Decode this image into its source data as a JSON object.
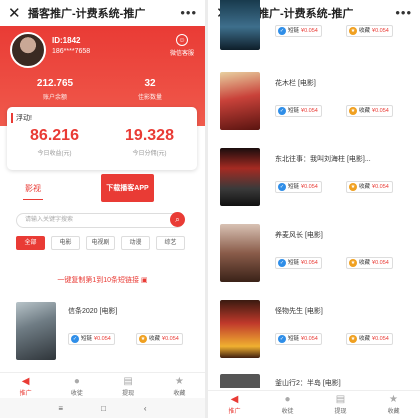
{
  "app": {
    "title": "播客推广-计费系统-推广"
  },
  "profile": {
    "id_label": "ID:1842",
    "phone": "186****7658",
    "service_label": "微信客服",
    "stats": [
      {
        "value": "212.765",
        "label": "账户余额"
      },
      {
        "value": "32",
        "label": "佳影数量"
      }
    ]
  },
  "earnings": {
    "notice": "浮动!",
    "today_income": {
      "value": "86.216",
      "label": "今日收益(元)"
    },
    "today_extract": {
      "value": "19.328",
      "label": "今日分佣(元)"
    }
  },
  "tabs": {
    "movie": "影视",
    "download": "下载播客APP"
  },
  "search": {
    "placeholder": "请输入关键字搜索"
  },
  "categories": [
    "全部",
    "电影",
    "电视剧",
    "动漫",
    "综艺"
  ],
  "copy_link": "一键复制第1到10条短链接",
  "pill_labels": {
    "short": "短链",
    "collect": "收藏",
    "price": "¥0.054"
  },
  "left_movies": [
    {
      "title": "信条2020 [电影]"
    }
  ],
  "right_movies": [
    {
      "title": ""
    },
    {
      "title": "花木栏 [电影]"
    },
    {
      "title": "东北往事：我叫刘海柱 [电影]..."
    },
    {
      "title": "养麦风长 [电影]"
    },
    {
      "title": "怪物先生 [电影]"
    },
    {
      "title": "釜山行2：半岛 [电影]"
    }
  ],
  "nav": [
    "推广",
    "收徒",
    "提现",
    "收藏"
  ],
  "colors": {
    "accent": "#e93b35"
  }
}
